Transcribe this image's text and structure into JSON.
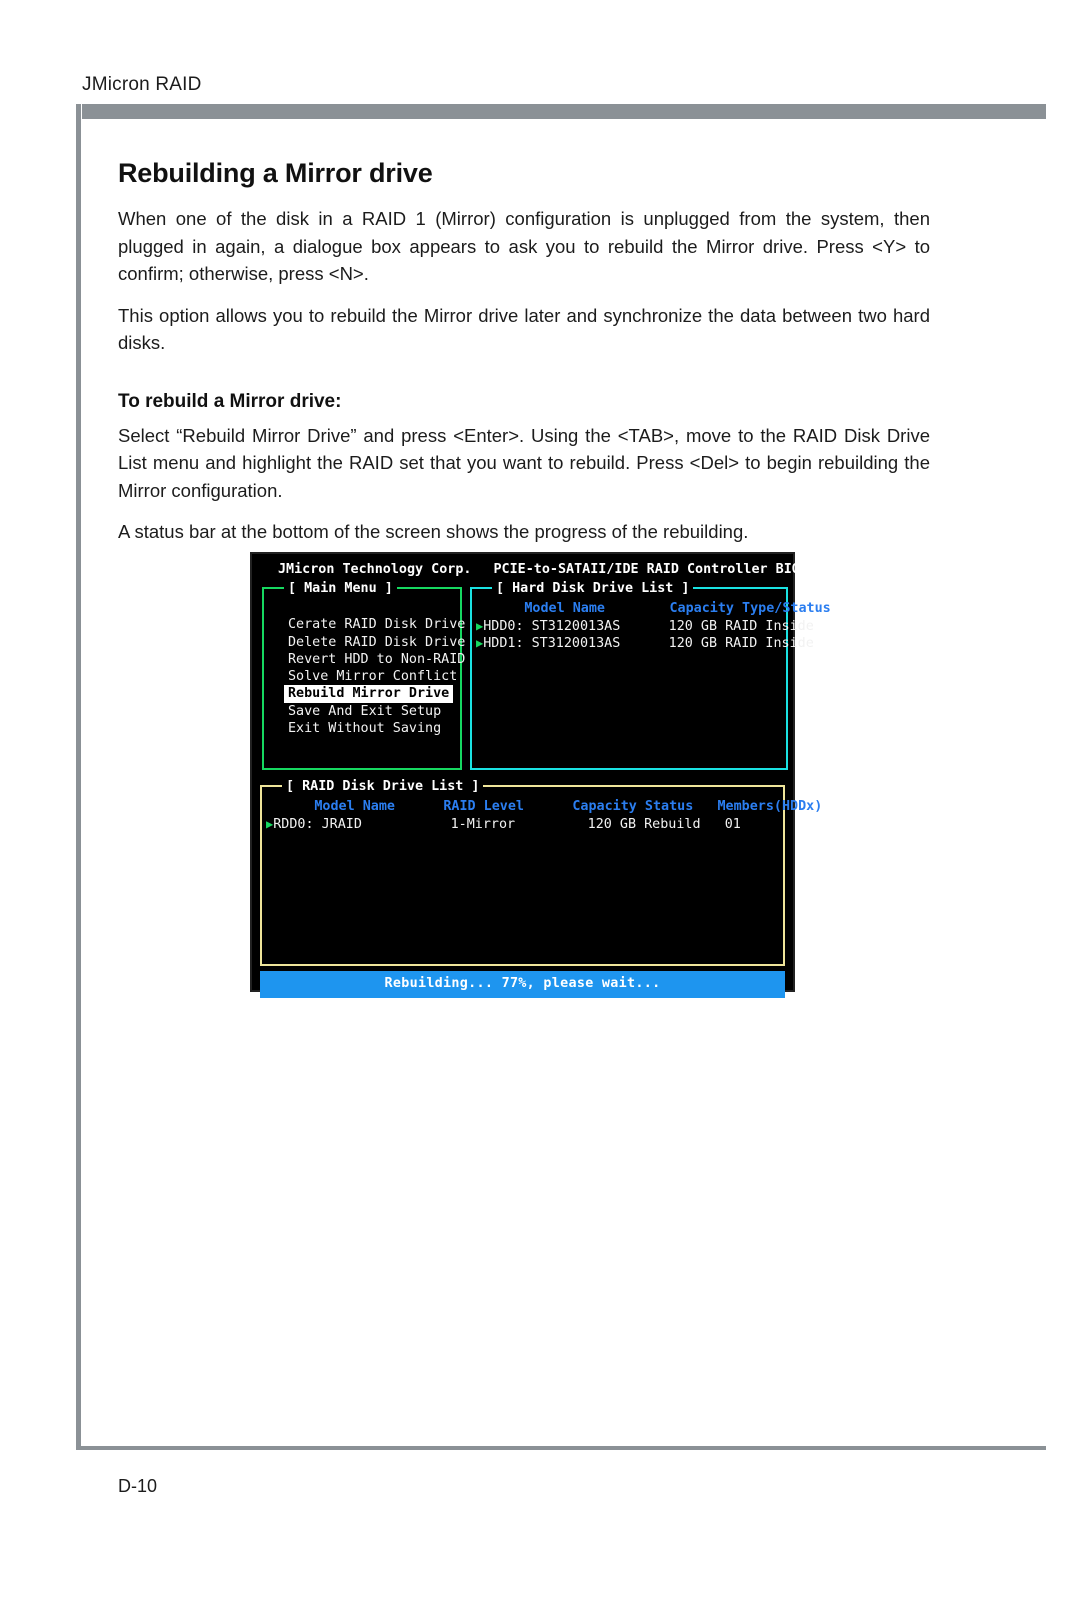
{
  "page": {
    "running_header": "JMicron RAID",
    "page_number": "D-10"
  },
  "content": {
    "section_title": "Rebuilding a Mirror drive",
    "para1": "When one of the disk in a RAID 1 (Mirror) configuration is unplugged from the system, then plugged in again, a dialogue box appears to ask you to rebuild the Mirror drive. Press <Y> to confirm; otherwise, press <N>.",
    "para2": "This option allows you to rebuild the Mirror drive later and synchronize the data between two hard disks.",
    "sub_title": "To rebuild a Mirror drive:",
    "para3": "Select “Rebuild Mirror Drive” and press <Enter>. Using the <TAB>, move to the RAID Disk Drive List menu and highlight the RAID set that you want to rebuild. Press <Del> to begin rebuilding the Mirror configuration.",
    "para4": "A status bar at the bottom of the screen shows the progress of the rebuilding."
  },
  "bios": {
    "title_left": "JMicron Technology Corp.",
    "title_right": "PCIE-to-SATAII/IDE RAID Controller BIOS",
    "main_menu": {
      "legend": "[ Main Menu ]",
      "border_color": "#16d860",
      "items": [
        {
          "label": "Cerate RAID Disk Drive",
          "selected": false
        },
        {
          "label": "Delete RAID Disk Drive",
          "selected": false
        },
        {
          "label": "Revert HDD to Non-RAID",
          "selected": false
        },
        {
          "label": "Solve Mirror Conflict",
          "selected": false
        },
        {
          "label": "Rebuild Mirror Drive",
          "selected": true
        },
        {
          "label": "Save And Exit Setup",
          "selected": false
        },
        {
          "label": "Exit Without Saving",
          "selected": false
        }
      ]
    },
    "hard_disk_list": {
      "legend": "[ Hard Disk Drive List ]",
      "border_color": "#1ae2e2",
      "header_color": "#2b7ef0",
      "columns": [
        "Model Name",
        "Capacity",
        "Type/Status"
      ],
      "header_line": "      Model Name        Capacity Type/Status",
      "rows": [
        {
          "line": "HDD0: ST3120013AS      120 GB RAID Inside",
          "drive": "HDD0:",
          "model": "ST3120013AS",
          "capacity": "120 GB",
          "type_status": "RAID Inside"
        },
        {
          "line": "HDD1: ST3120013AS      120 GB RAID Inside",
          "drive": "HDD1:",
          "model": "ST3120013AS",
          "capacity": "120 GB",
          "type_status": "RAID Inside"
        }
      ]
    },
    "raid_disk_list": {
      "legend": "[ RAID Disk Drive List ]",
      "border_color": "#efe59a",
      "header_color": "#2b7ef0",
      "columns": [
        "Model Name",
        "RAID Level",
        "Capacity Status",
        "Members(HDDx)"
      ],
      "header_line": "      Model Name      RAID Level      Capacity Status   Members(HDDx)",
      "rows": [
        {
          "line": "RDD0: JRAID           1-Mirror         120 GB Rebuild   01",
          "drive": "RDD0:",
          "model": "JRAID",
          "raid_level": "1-Mirror",
          "capacity_status": "120 GB Rebuild",
          "members": "01"
        }
      ]
    },
    "status_bar": {
      "text": "Rebuilding... 77%, please wait...",
      "background": "#1e95ef",
      "progress_percent": 77
    }
  }
}
